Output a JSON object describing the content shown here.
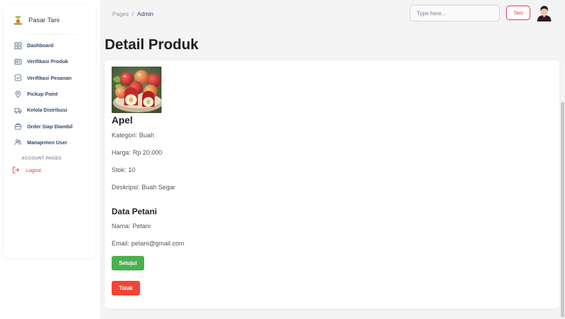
{
  "colors": {
    "accent": "#e53950",
    "approve": "#4caf50",
    "reject": "#f44336",
    "logout": "#e53935"
  },
  "brand": {
    "name": "Pasar Tani",
    "logo_icon": "farmer-icon"
  },
  "sidebar": {
    "items": [
      {
        "label": "Dashboard",
        "icon": "dashboard-icon"
      },
      {
        "label": "Verifikasi Produk",
        "icon": "product-card-icon"
      },
      {
        "label": "Verifikasi Pesanan",
        "icon": "checklist-icon"
      },
      {
        "label": "Pickup Point",
        "icon": "map-pin-icon"
      },
      {
        "label": "Kelola Distribusi",
        "icon": "truck-icon"
      },
      {
        "label": "Order Siap Diambil",
        "icon": "package-icon"
      },
      {
        "label": "Manajemen User",
        "icon": "users-icon"
      }
    ],
    "section_title": "ACCOUNT PAGES",
    "logout_label": "Logout"
  },
  "header": {
    "breadcrumb": {
      "parent": "Pages",
      "separator": "/",
      "current": "Admin"
    },
    "search_placeholder": "Type here...",
    "user_button": "Tani"
  },
  "page_title": "Detail Produk",
  "product": {
    "name": "Apel",
    "image_alt": "Apel",
    "category_label": "Kategori:",
    "category": "Buah",
    "price_label": "Harga:",
    "price": "Rp 20.000",
    "stock_label": "Stok:",
    "stock": "10",
    "description_label": "Deskripsi:",
    "description": "Buah Segar"
  },
  "farmer": {
    "heading": "Data Petani",
    "name_label": "Nama:",
    "name": "Petani",
    "email_label": "Email:",
    "email": "petani@gmail.com"
  },
  "actions": {
    "approve": "Setujui",
    "reject": "Tolak"
  }
}
